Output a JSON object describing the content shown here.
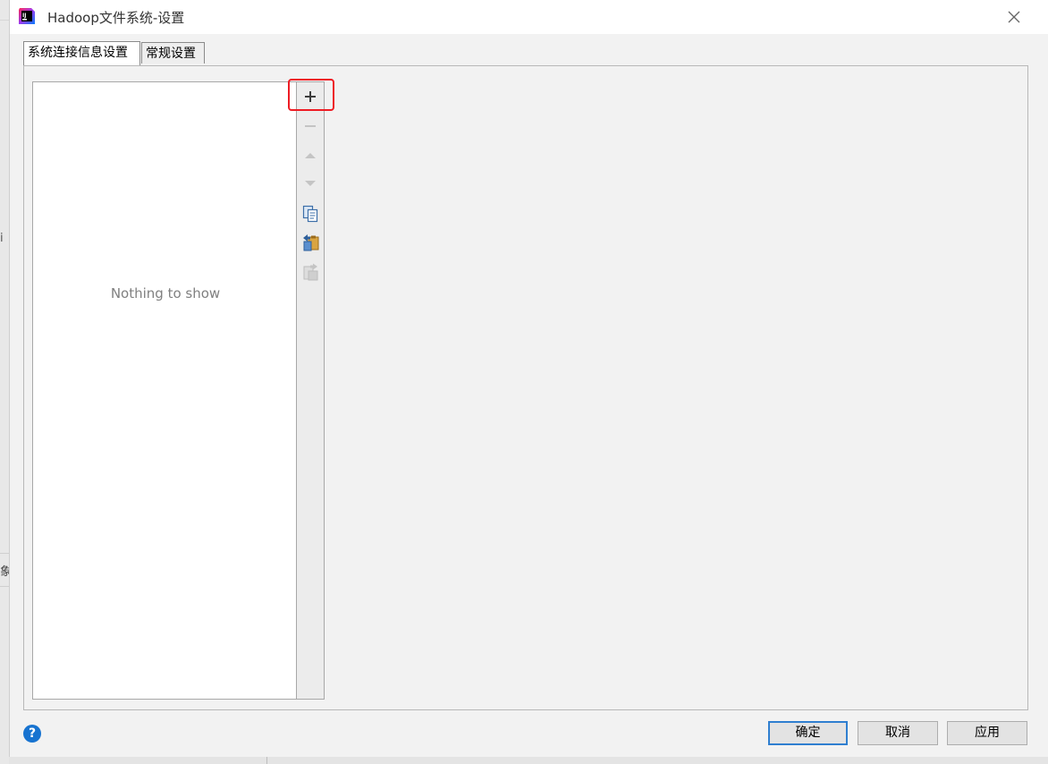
{
  "background_app": {
    "text_top": "i",
    "text_bottom": "象"
  },
  "dialog": {
    "title": "Hadoop文件系统-设置",
    "app_icon": "intellij-idea-icon",
    "close_icon": "close-icon"
  },
  "tabs": [
    {
      "label": "系统连接信息设置",
      "selected": true
    },
    {
      "label": "常规设置",
      "selected": false
    }
  ],
  "connections_list": {
    "empty_text": "Nothing to show",
    "items": []
  },
  "list_toolbar": {
    "buttons": [
      {
        "icon": "plus-icon",
        "enabled": true
      },
      {
        "icon": "minus-icon",
        "enabled": false
      },
      {
        "icon": "move-up-icon",
        "enabled": false
      },
      {
        "icon": "move-down-icon",
        "enabled": false
      },
      {
        "icon": "copy-icon",
        "enabled": true
      },
      {
        "icon": "import-icon",
        "enabled": true
      },
      {
        "icon": "export-icon",
        "enabled": false
      }
    ]
  },
  "footer": {
    "help_label": "?",
    "ok_label": "确定",
    "cancel_label": "取消",
    "apply_label": "应用"
  },
  "colors": {
    "highlight": "#ee1c24",
    "help": "#1773d0",
    "default_button_border": "#2f7fd0"
  }
}
